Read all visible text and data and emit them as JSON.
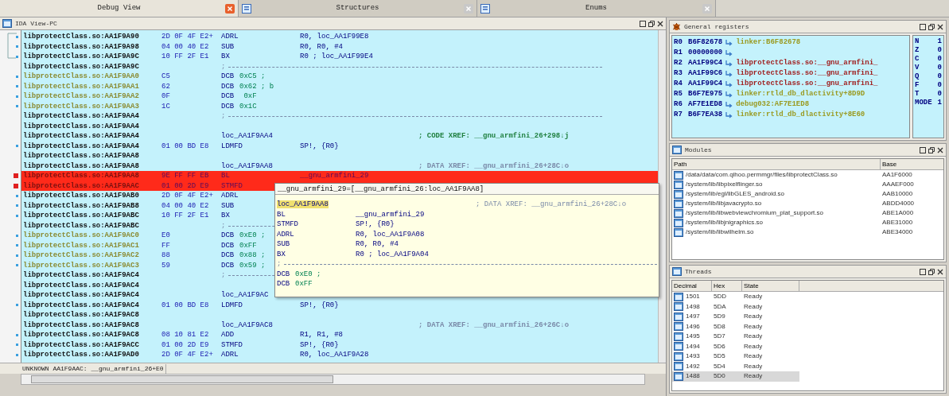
{
  "tabs": [
    {
      "label": "Debug View",
      "selected": true
    },
    {
      "label": "Structures",
      "selected": false
    },
    {
      "label": "Enums",
      "selected": false
    }
  ],
  "ida_view": {
    "title": "IDA View-PC",
    "rows": [
      {
        "kind": "code",
        "address": "libprotectClass.so:AA1F9A90",
        "bytes": "2D 0F 4F E2+",
        "mnemonic": "ADRL",
        "operand": "R0, loc_AA1F99E8",
        "breakpoint": false
      },
      {
        "kind": "code",
        "address": "libprotectClass.so:AA1F9A98",
        "bytes": "04 00 40 E2",
        "mnemonic": "SUB",
        "operand": "R0, R0, #4",
        "breakpoint": false
      },
      {
        "kind": "code",
        "address": "libprotectClass.so:AA1F9A9C",
        "bytes": "10 FF 2F E1",
        "mnemonic": "BX",
        "operand": "R0 ; loc_AA1F99E4",
        "breakpoint": false
      },
      {
        "kind": "separator",
        "address": "libprotectClass.so:AA1F9A9C",
        "mnemonic": ";",
        "breakpoint": false
      },
      {
        "kind": "data",
        "address": "libprotectClass.so:AA1F9AA0",
        "bytes": "C5",
        "mnemonic": "DCB",
        "operand": "0xC5 ;",
        "breakpoint": false
      },
      {
        "kind": "data",
        "address": "libprotectClass.so:AA1F9AA1",
        "bytes": "62",
        "mnemonic": "DCB",
        "operand": "0x62 ; b",
        "breakpoint": false
      },
      {
        "kind": "data",
        "address": "libprotectClass.so:AA1F9AA2",
        "bytes": "0F",
        "mnemonic": "DCB",
        "operand": " 0xF",
        "breakpoint": false
      },
      {
        "kind": "data",
        "address": "libprotectClass.so:AA1F9AA3",
        "bytes": "1C",
        "mnemonic": "DCB",
        "operand": "0x1C",
        "breakpoint": false
      },
      {
        "kind": "separator",
        "address": "libprotectClass.so:AA1F9AA4",
        "mnemonic": ";",
        "breakpoint": false
      },
      {
        "kind": "blank",
        "address": "libprotectClass.so:AA1F9AA4",
        "breakpoint": false
      },
      {
        "kind": "label",
        "address": "libprotectClass.so:AA1F9AA4",
        "mnemonic": "loc_AA1F9AA4",
        "comment": "; CODE XREF: __gnu_armfini_26+298↓j",
        "color": "#208040",
        "breakpoint": false
      },
      {
        "kind": "code",
        "address": "libprotectClass.so:AA1F9AA4",
        "bytes": "01 00 BD E8",
        "mnemonic": "LDMFD",
        "operand": "SP!, {R0}",
        "breakpoint": false
      },
      {
        "kind": "blank",
        "address": "libprotectClass.so:AA1F9AA8",
        "breakpoint": false
      },
      {
        "kind": "label",
        "address": "libprotectClass.so:AA1F9AA8",
        "mnemonic": "loc_AA1F9AA8",
        "comment": "; DATA XREF: __gnu_armfini_26+28C↓o",
        "color": "#7a8aa8",
        "breakpoint": false
      },
      {
        "kind": "code",
        "address": "libprotectClass.so:AA1F9AA8",
        "bytes": "9E FF FF EB",
        "mnemonic": "BL",
        "operand": "__gnu_armfini_29",
        "breakpoint": true
      },
      {
        "kind": "code",
        "address": "libprotectClass.so:AA1F9AAC",
        "bytes": "01 00 2D E9",
        "mnemonic": "STMFD",
        "breakpoint": true
      },
      {
        "kind": "code",
        "address": "libprotectClass.so:AA1F9AB0",
        "bytes": "2D 0F 4F E2+",
        "mnemonic": "ADRL",
        "breakpoint": false
      },
      {
        "kind": "code",
        "address": "libprotectClass.so:AA1F9AB8",
        "bytes": "04 00 40 E2",
        "mnemonic": "SUB",
        "breakpoint": false
      },
      {
        "kind": "code",
        "address": "libprotectClass.so:AA1F9ABC",
        "bytes": "10 FF 2F E1",
        "mnemonic": "BX",
        "breakpoint": false
      },
      {
        "kind": "separator",
        "address": "libprotectClass.so:AA1F9ABC",
        "mnemonic": ";",
        "breakpoint": false
      },
      {
        "kind": "data",
        "address": "libprotectClass.so:AA1F9AC0",
        "bytes": "E0",
        "mnemonic": "DCB",
        "operand": "0xE0 ;",
        "breakpoint": false
      },
      {
        "kind": "data",
        "address": "libprotectClass.so:AA1F9AC1",
        "bytes": "FF",
        "mnemonic": "DCB",
        "operand": "0xFF",
        "breakpoint": false
      },
      {
        "kind": "data",
        "address": "libprotectClass.so:AA1F9AC2",
        "bytes": "88",
        "mnemonic": "DCB",
        "operand": "0x88 ;",
        "breakpoint": false
      },
      {
        "kind": "data",
        "address": "libprotectClass.so:AA1F9AC3",
        "bytes": "59",
        "mnemonic": "DCB",
        "operand": "0x59 ;",
        "breakpoint": false
      },
      {
        "kind": "separator",
        "address": "libprotectClass.so:AA1F9AC4",
        "mnemonic": ";",
        "breakpoint": false
      },
      {
        "kind": "blank",
        "address": "libprotectClass.so:AA1F9AC4",
        "breakpoint": false
      },
      {
        "kind": "label",
        "address": "libprotectClass.so:AA1F9AC4",
        "mnemonic": "loc_AA1F9AC",
        "breakpoint": false
      },
      {
        "kind": "code",
        "address": "libprotectClass.so:AA1F9AC4",
        "bytes": "01 00 BD E8",
        "mnemonic": "LDMFD",
        "operand": "SP!, {R0}",
        "breakpoint": false
      },
      {
        "kind": "blank",
        "address": "libprotectClass.so:AA1F9AC8",
        "breakpoint": false
      },
      {
        "kind": "label",
        "address": "libprotectClass.so:AA1F9AC8",
        "mnemonic": "loc_AA1F9AC8",
        "comment": "; DATA XREF: __gnu_armfini_26+26C↓o",
        "color": "#7a8aa8",
        "breakpoint": false
      },
      {
        "kind": "code",
        "address": "libprotectClass.so:AA1F9AC8",
        "bytes": "08 10 81 E2",
        "mnemonic": "ADD",
        "operand": "R1, R1, #8",
        "breakpoint": false
      },
      {
        "kind": "code",
        "address": "libprotectClass.so:AA1F9ACC",
        "bytes": "01 00 2D E9",
        "mnemonic": "STMFD",
        "operand": "SP!, {R0}",
        "breakpoint": false
      },
      {
        "kind": "code",
        "address": "libprotectClass.so:AA1F9AD0",
        "bytes": "2D 0F 4F E2+",
        "mnemonic": "ADRL",
        "operand": "R0, loc_AA1F9A28",
        "breakpoint": false
      }
    ],
    "tooltip": {
      "header": "__gnu_armfini_29=[__gnu_armfini_26:loc_AA1F9AA8]",
      "lines": [
        {
          "kind": "label",
          "mnemonic": "loc_AA1F9AA8",
          "comment": "; DATA XREF: __gnu_armfini_26+28C↓o"
        },
        {
          "kind": "code",
          "mnemonic": "BL",
          "operand": "__gnu_armfini_29"
        },
        {
          "kind": "code",
          "mnemonic": "STMFD",
          "operand": "SP!, {R0}"
        },
        {
          "kind": "code",
          "mnemonic": "ADRL",
          "operand": "R0, loc_AA1F9A08"
        },
        {
          "kind": "code",
          "mnemonic": "SUB",
          "operand": "R0, R0, #4"
        },
        {
          "kind": "code",
          "mnemonic": "BX",
          "operand": "R0 ; loc_AA1F9A04"
        },
        {
          "kind": "separator",
          "mnemonic": ";"
        },
        {
          "kind": "data",
          "mnemonic": "DCB",
          "operand": "0xE0 ;"
        },
        {
          "kind": "data",
          "mnemonic": "DCB",
          "operand": "0xFF"
        }
      ]
    },
    "status": "UNKNOWN AA1F9AAC: __gnu_armfini_26+E0"
  },
  "registers": {
    "title": "General registers",
    "rows": [
      {
        "name": "R0",
        "value": "B6F82678",
        "comment": "linker:B6F82678",
        "color": "#9a9a20"
      },
      {
        "name": "R1",
        "value": "00000000"
      },
      {
        "name": "R2",
        "value": "AA1F99C4",
        "comment": "libprotectClass.so:__gnu_armfini_",
        "color": "#a02020"
      },
      {
        "name": "R3",
        "value": "AA1F99C6",
        "comment": "libprotectClass.so:__gnu_armfini_",
        "color": "#a02020"
      },
      {
        "name": "R4",
        "value": "AA1F99C4",
        "comment": "libprotectClass.so:__gnu_armfini_",
        "color": "#a02020"
      },
      {
        "name": "R5",
        "value": "B6F7E975",
        "comment": "linker:rtld_db_dlactivity+8D9D",
        "color": "#9a9a20"
      },
      {
        "name": "R6",
        "value": "AF7E1ED8",
        "comment": "debug032:AF7E1ED8",
        "color": "#9a9a20"
      },
      {
        "name": "R7",
        "value": "B6F7EA38",
        "comment": "linker:rtld_db_dlactivity+8E60",
        "color": "#9a9a20"
      }
    ],
    "flags": [
      {
        "name": "N",
        "value": "1"
      },
      {
        "name": "Z",
        "value": "0"
      },
      {
        "name": "C",
        "value": "0"
      },
      {
        "name": "V",
        "value": "0"
      },
      {
        "name": "Q",
        "value": "0"
      },
      {
        "name": "F",
        "value": "0"
      },
      {
        "name": "T",
        "value": "0"
      },
      {
        "name": "MODE",
        "value": "1"
      }
    ]
  },
  "modules": {
    "title": "Modules",
    "columns": [
      "Path",
      "Base"
    ],
    "rows": [
      {
        "path": "/data/data/com.qihoo.permmgr/files/libprotectClass.so",
        "base": "AA1F6000"
      },
      {
        "path": "/system/lib/libpixelflinger.so",
        "base": "AAAEF000"
      },
      {
        "path": "/system/lib/egl/libGLES_android.so",
        "base": "AAB10000"
      },
      {
        "path": "/system/lib/libjavacrypto.so",
        "base": "ABDD4000"
      },
      {
        "path": "/system/lib/libwebviewchromium_plat_support.so",
        "base": "ABE1A000"
      },
      {
        "path": "/system/lib/libjnigraphics.so",
        "base": "ABE31000"
      },
      {
        "path": "/system/lib/libwilhelm.so",
        "base": "ABE34000"
      }
    ]
  },
  "threads": {
    "title": "Threads",
    "columns": [
      "Decimal",
      "Hex",
      "State"
    ],
    "rows": [
      {
        "decimal": "1501",
        "hex": "5DD",
        "state": "Ready",
        "selected": false
      },
      {
        "decimal": "1498",
        "hex": "5DA",
        "state": "Ready",
        "selected": false
      },
      {
        "decimal": "1497",
        "hex": "5D9",
        "state": "Ready",
        "selected": false
      },
      {
        "decimal": "1496",
        "hex": "5D8",
        "state": "Ready",
        "selected": false
      },
      {
        "decimal": "1495",
        "hex": "5D7",
        "state": "Ready",
        "selected": false
      },
      {
        "decimal": "1494",
        "hex": "5D6",
        "state": "Ready",
        "selected": false
      },
      {
        "decimal": "1493",
        "hex": "5D5",
        "state": "Ready",
        "selected": false
      },
      {
        "decimal": "1492",
        "hex": "5D4",
        "state": "Ready",
        "selected": false
      },
      {
        "decimal": "1488",
        "hex": "5D0",
        "state": "Ready",
        "selected": true
      }
    ]
  }
}
